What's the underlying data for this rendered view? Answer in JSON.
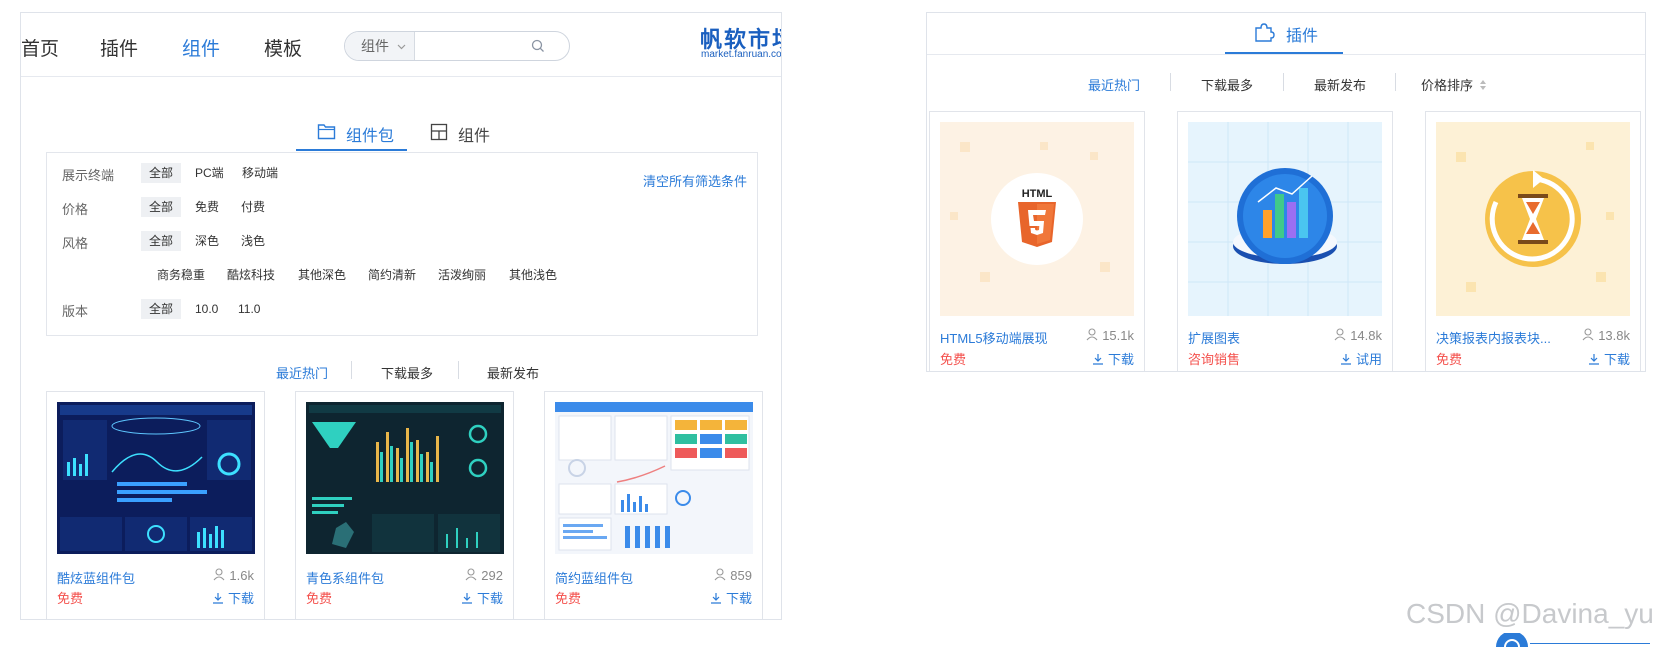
{
  "left": {
    "nav": [
      "首页",
      "插件",
      "组件",
      "模板"
    ],
    "search": {
      "select_value": "组件",
      "placeholder": ""
    },
    "logo": {
      "cn": "帆软市场",
      "en": "market.fanruan.com"
    },
    "tabs": [
      "组件包",
      "组件"
    ],
    "filters": {
      "row1": {
        "label": "展示终端",
        "options": [
          "全部",
          "PC端",
          "移动端"
        ]
      },
      "row2": {
        "label": "价格",
        "options": [
          "全部",
          "免费",
          "付费"
        ]
      },
      "row3": {
        "label": "风格",
        "options": [
          "全部",
          "深色",
          "浅色"
        ]
      },
      "row3b": {
        "options": [
          "商务稳重",
          "酷炫科技",
          "其他深色",
          "简约清新",
          "活泼绚丽",
          "其他浅色"
        ]
      },
      "row4": {
        "label": "版本",
        "options": [
          "全部",
          "10.0",
          "11.0"
        ]
      },
      "clear": "清空所有筛选条件"
    },
    "sort": [
      "最近热门",
      "下载最多",
      "最新发布"
    ],
    "cards": [
      {
        "title": "酷炫蓝组件包",
        "count": "1.6k",
        "price": "免费",
        "action": "下载"
      },
      {
        "title": "青色系组件包",
        "count": "292",
        "price": "免费",
        "action": "下载"
      },
      {
        "title": "简约蓝组件包",
        "count": "859",
        "price": "免费",
        "action": "下载"
      }
    ]
  },
  "right": {
    "tab": "插件",
    "sort": [
      "最近热门",
      "下载最多",
      "最新发布",
      "价格排序"
    ],
    "cards": [
      {
        "title": "HTML5移动端展现",
        "count": "15.1k",
        "price": "免费",
        "action": "下载",
        "icon_text": "HTML"
      },
      {
        "title": "扩展图表",
        "count": "14.8k",
        "price": "咨询销售",
        "action": "试用"
      },
      {
        "title": "决策报表内报表块...",
        "count": "13.8k",
        "price": "免费",
        "action": "下载"
      }
    ]
  },
  "watermark": "CSDN @Davina_yu",
  "colors": {
    "accent": "#2b7bd8",
    "price_red": "#f4504c",
    "brand": "#1a5fbf"
  }
}
